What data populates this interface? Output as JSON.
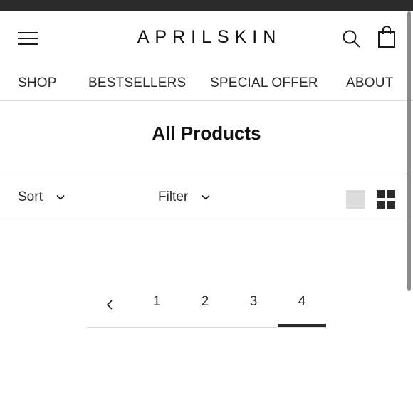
{
  "brand": {
    "logo_text": "APRILSKIN"
  },
  "header": {
    "icons": {
      "menu": "hamburger-menu-icon",
      "search": "search-icon",
      "cart": "shopping-bag-icon"
    }
  },
  "nav": {
    "items": [
      {
        "label": "SHOP"
      },
      {
        "label": "BESTSELLERS"
      },
      {
        "label": "SPECIAL OFFER"
      },
      {
        "label": "ABOUT"
      }
    ]
  },
  "main": {
    "title": "All Products"
  },
  "toolbar": {
    "sort_label": "Sort",
    "filter_label": "Filter",
    "view_modes": [
      "single",
      "grid"
    ],
    "active_view": "grid"
  },
  "pagination": {
    "pages": [
      "1",
      "2",
      "3",
      "4"
    ],
    "current": "4"
  },
  "colors": {
    "text": "#1a1a1a",
    "top_bar": "#2b2b2b",
    "divider": "#dcdcdc",
    "inactive_view": "#dcdcdc"
  }
}
